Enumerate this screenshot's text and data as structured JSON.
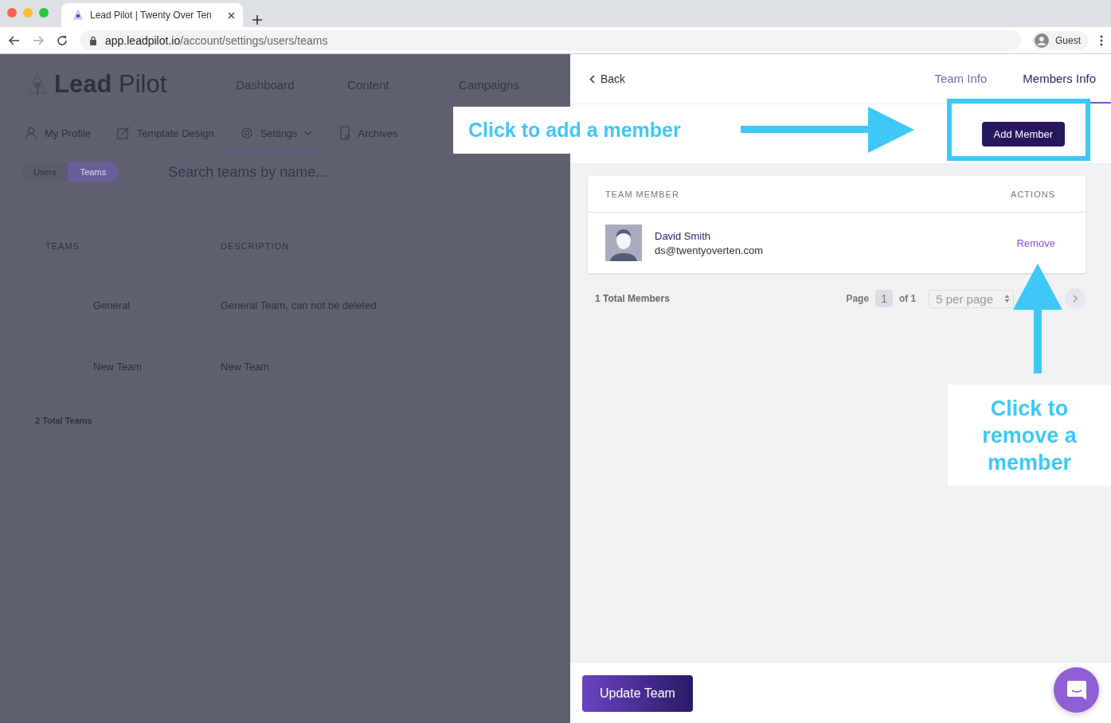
{
  "browser": {
    "tab_title": "Lead Pilot | Twenty Over Ten",
    "url_host": "app.leadpilot.io",
    "url_path": "/account/settings/users/teams",
    "profile": "Guest"
  },
  "app": {
    "logo_bold": "Lead",
    "logo_light": "Pilot",
    "nav": [
      "Dashboard",
      "Content",
      "Campaigns"
    ],
    "subnav": [
      {
        "label": "My Profile",
        "selected": false
      },
      {
        "label": "Template Design",
        "selected": false
      },
      {
        "label": "Settings",
        "selected": true
      },
      {
        "label": "Archives",
        "selected": false
      }
    ],
    "toggle": [
      {
        "label": "Users",
        "selected": false
      },
      {
        "label": "Teams",
        "selected": true
      }
    ],
    "search": {
      "placeholder": "Search teams by name..."
    },
    "table": {
      "columns": [
        "TEAMS",
        "DESCRIPTION"
      ],
      "rows": [
        [
          "General",
          "General Team, can not be deleted"
        ],
        [
          "New Team",
          "New Team"
        ]
      ]
    },
    "total": "2 Total Teams"
  },
  "panel": {
    "back": "Back",
    "tabs": [
      {
        "label": "Team Info",
        "selected": false
      },
      {
        "label": "Members Info",
        "selected": true
      }
    ],
    "add_button": "Add Member",
    "members_table": {
      "columns": [
        "TEAM MEMBER",
        "ACTIONS"
      ],
      "rows": [
        {
          "name": "David Smith",
          "email": "ds@twentyoverten.com",
          "action": "Remove"
        }
      ]
    },
    "total": "1 Total Members",
    "page_label": "Page",
    "page": "1",
    "of": "of 1",
    "per_page": "5 per page",
    "update_button": "Update Team"
  },
  "annotations": [
    {
      "text": "Click to add a member"
    },
    {
      "text": "Click to remove a member"
    }
  ]
}
